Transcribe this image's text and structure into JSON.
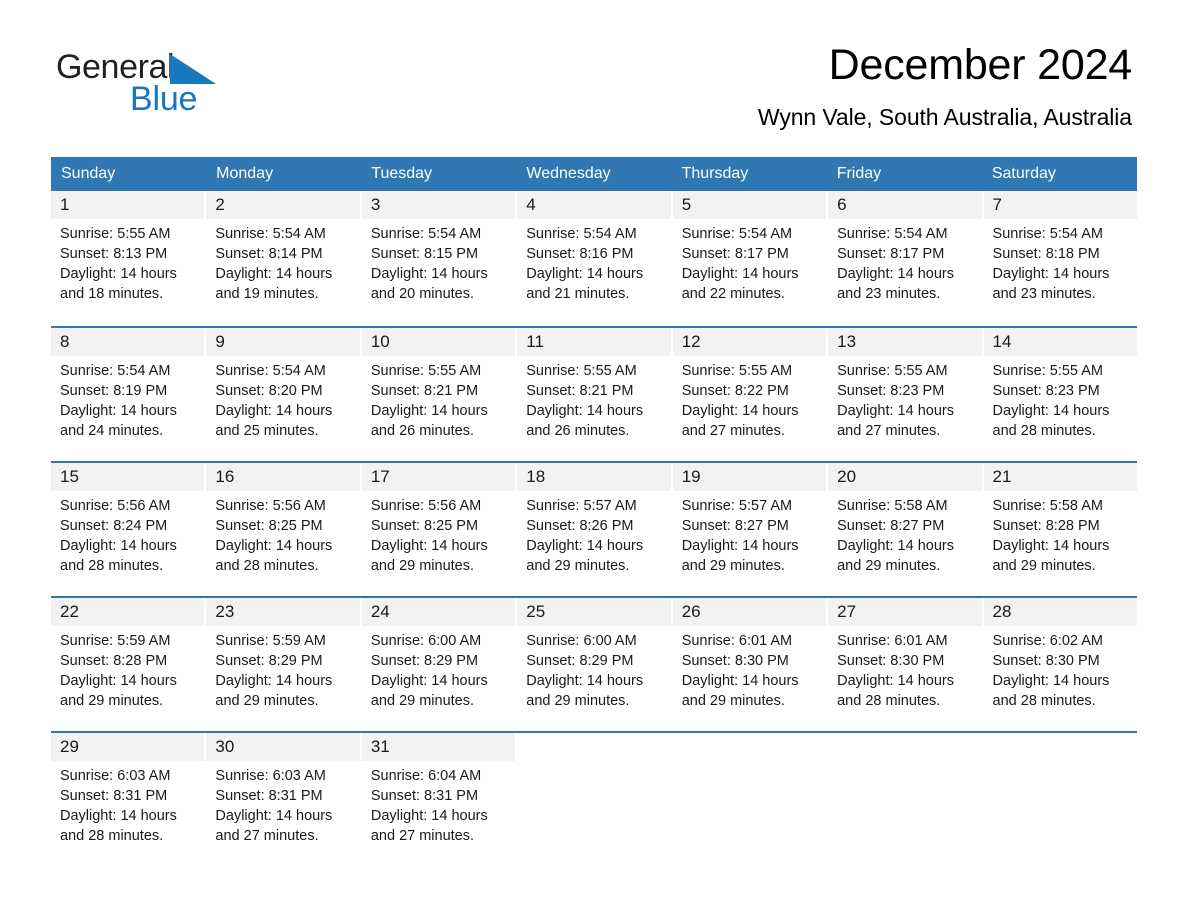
{
  "brand": {
    "name_part1": "General",
    "name_part2": "Blue",
    "triangle_color": "#1878bd"
  },
  "header": {
    "title": "December 2024",
    "subtitle": "Wynn Vale, South Australia, Australia"
  },
  "theme": {
    "header_blue": "#3077b4",
    "day_band_gray": "#f2f2f2",
    "text_black": "#1a1a1a"
  },
  "calendar": {
    "weekdays": [
      "Sunday",
      "Monday",
      "Tuesday",
      "Wednesday",
      "Thursday",
      "Friday",
      "Saturday"
    ],
    "weeks": [
      [
        {
          "day": "1",
          "sunrise": "Sunrise: 5:55 AM",
          "sunset": "Sunset: 8:13 PM",
          "daylight_line1": "Daylight: 14 hours",
          "daylight_line2": "and 18 minutes."
        },
        {
          "day": "2",
          "sunrise": "Sunrise: 5:54 AM",
          "sunset": "Sunset: 8:14 PM",
          "daylight_line1": "Daylight: 14 hours",
          "daylight_line2": "and 19 minutes."
        },
        {
          "day": "3",
          "sunrise": "Sunrise: 5:54 AM",
          "sunset": "Sunset: 8:15 PM",
          "daylight_line1": "Daylight: 14 hours",
          "daylight_line2": "and 20 minutes."
        },
        {
          "day": "4",
          "sunrise": "Sunrise: 5:54 AM",
          "sunset": "Sunset: 8:16 PM",
          "daylight_line1": "Daylight: 14 hours",
          "daylight_line2": "and 21 minutes."
        },
        {
          "day": "5",
          "sunrise": "Sunrise: 5:54 AM",
          "sunset": "Sunset: 8:17 PM",
          "daylight_line1": "Daylight: 14 hours",
          "daylight_line2": "and 22 minutes."
        },
        {
          "day": "6",
          "sunrise": "Sunrise: 5:54 AM",
          "sunset": "Sunset: 8:17 PM",
          "daylight_line1": "Daylight: 14 hours",
          "daylight_line2": "and 23 minutes."
        },
        {
          "day": "7",
          "sunrise": "Sunrise: 5:54 AM",
          "sunset": "Sunset: 8:18 PM",
          "daylight_line1": "Daylight: 14 hours",
          "daylight_line2": "and 23 minutes."
        }
      ],
      [
        {
          "day": "8",
          "sunrise": "Sunrise: 5:54 AM",
          "sunset": "Sunset: 8:19 PM",
          "daylight_line1": "Daylight: 14 hours",
          "daylight_line2": "and 24 minutes."
        },
        {
          "day": "9",
          "sunrise": "Sunrise: 5:54 AM",
          "sunset": "Sunset: 8:20 PM",
          "daylight_line1": "Daylight: 14 hours",
          "daylight_line2": "and 25 minutes."
        },
        {
          "day": "10",
          "sunrise": "Sunrise: 5:55 AM",
          "sunset": "Sunset: 8:21 PM",
          "daylight_line1": "Daylight: 14 hours",
          "daylight_line2": "and 26 minutes."
        },
        {
          "day": "11",
          "sunrise": "Sunrise: 5:55 AM",
          "sunset": "Sunset: 8:21 PM",
          "daylight_line1": "Daylight: 14 hours",
          "daylight_line2": "and 26 minutes."
        },
        {
          "day": "12",
          "sunrise": "Sunrise: 5:55 AM",
          "sunset": "Sunset: 8:22 PM",
          "daylight_line1": "Daylight: 14 hours",
          "daylight_line2": "and 27 minutes."
        },
        {
          "day": "13",
          "sunrise": "Sunrise: 5:55 AM",
          "sunset": "Sunset: 8:23 PM",
          "daylight_line1": "Daylight: 14 hours",
          "daylight_line2": "and 27 minutes."
        },
        {
          "day": "14",
          "sunrise": "Sunrise: 5:55 AM",
          "sunset": "Sunset: 8:23 PM",
          "daylight_line1": "Daylight: 14 hours",
          "daylight_line2": "and 28 minutes."
        }
      ],
      [
        {
          "day": "15",
          "sunrise": "Sunrise: 5:56 AM",
          "sunset": "Sunset: 8:24 PM",
          "daylight_line1": "Daylight: 14 hours",
          "daylight_line2": "and 28 minutes."
        },
        {
          "day": "16",
          "sunrise": "Sunrise: 5:56 AM",
          "sunset": "Sunset: 8:25 PM",
          "daylight_line1": "Daylight: 14 hours",
          "daylight_line2": "and 28 minutes."
        },
        {
          "day": "17",
          "sunrise": "Sunrise: 5:56 AM",
          "sunset": "Sunset: 8:25 PM",
          "daylight_line1": "Daylight: 14 hours",
          "daylight_line2": "and 29 minutes."
        },
        {
          "day": "18",
          "sunrise": "Sunrise: 5:57 AM",
          "sunset": "Sunset: 8:26 PM",
          "daylight_line1": "Daylight: 14 hours",
          "daylight_line2": "and 29 minutes."
        },
        {
          "day": "19",
          "sunrise": "Sunrise: 5:57 AM",
          "sunset": "Sunset: 8:27 PM",
          "daylight_line1": "Daylight: 14 hours",
          "daylight_line2": "and 29 minutes."
        },
        {
          "day": "20",
          "sunrise": "Sunrise: 5:58 AM",
          "sunset": "Sunset: 8:27 PM",
          "daylight_line1": "Daylight: 14 hours",
          "daylight_line2": "and 29 minutes."
        },
        {
          "day": "21",
          "sunrise": "Sunrise: 5:58 AM",
          "sunset": "Sunset: 8:28 PM",
          "daylight_line1": "Daylight: 14 hours",
          "daylight_line2": "and 29 minutes."
        }
      ],
      [
        {
          "day": "22",
          "sunrise": "Sunrise: 5:59 AM",
          "sunset": "Sunset: 8:28 PM",
          "daylight_line1": "Daylight: 14 hours",
          "daylight_line2": "and 29 minutes."
        },
        {
          "day": "23",
          "sunrise": "Sunrise: 5:59 AM",
          "sunset": "Sunset: 8:29 PM",
          "daylight_line1": "Daylight: 14 hours",
          "daylight_line2": "and 29 minutes."
        },
        {
          "day": "24",
          "sunrise": "Sunrise: 6:00 AM",
          "sunset": "Sunset: 8:29 PM",
          "daylight_line1": "Daylight: 14 hours",
          "daylight_line2": "and 29 minutes."
        },
        {
          "day": "25",
          "sunrise": "Sunrise: 6:00 AM",
          "sunset": "Sunset: 8:29 PM",
          "daylight_line1": "Daylight: 14 hours",
          "daylight_line2": "and 29 minutes."
        },
        {
          "day": "26",
          "sunrise": "Sunrise: 6:01 AM",
          "sunset": "Sunset: 8:30 PM",
          "daylight_line1": "Daylight: 14 hours",
          "daylight_line2": "and 29 minutes."
        },
        {
          "day": "27",
          "sunrise": "Sunrise: 6:01 AM",
          "sunset": "Sunset: 8:30 PM",
          "daylight_line1": "Daylight: 14 hours",
          "daylight_line2": "and 28 minutes."
        },
        {
          "day": "28",
          "sunrise": "Sunrise: 6:02 AM",
          "sunset": "Sunset: 8:30 PM",
          "daylight_line1": "Daylight: 14 hours",
          "daylight_line2": "and 28 minutes."
        }
      ],
      [
        {
          "day": "29",
          "sunrise": "Sunrise: 6:03 AM",
          "sunset": "Sunset: 8:31 PM",
          "daylight_line1": "Daylight: 14 hours",
          "daylight_line2": "and 28 minutes."
        },
        {
          "day": "30",
          "sunrise": "Sunrise: 6:03 AM",
          "sunset": "Sunset: 8:31 PM",
          "daylight_line1": "Daylight: 14 hours",
          "daylight_line2": "and 27 minutes."
        },
        {
          "day": "31",
          "sunrise": "Sunrise: 6:04 AM",
          "sunset": "Sunset: 8:31 PM",
          "daylight_line1": "Daylight: 14 hours",
          "daylight_line2": "and 27 minutes."
        },
        {
          "day": "",
          "sunrise": "",
          "sunset": "",
          "daylight_line1": "",
          "daylight_line2": ""
        },
        {
          "day": "",
          "sunrise": "",
          "sunset": "",
          "daylight_line1": "",
          "daylight_line2": ""
        },
        {
          "day": "",
          "sunrise": "",
          "sunset": "",
          "daylight_line1": "",
          "daylight_line2": ""
        },
        {
          "day": "",
          "sunrise": "",
          "sunset": "",
          "daylight_line1": "",
          "daylight_line2": ""
        }
      ]
    ]
  }
}
